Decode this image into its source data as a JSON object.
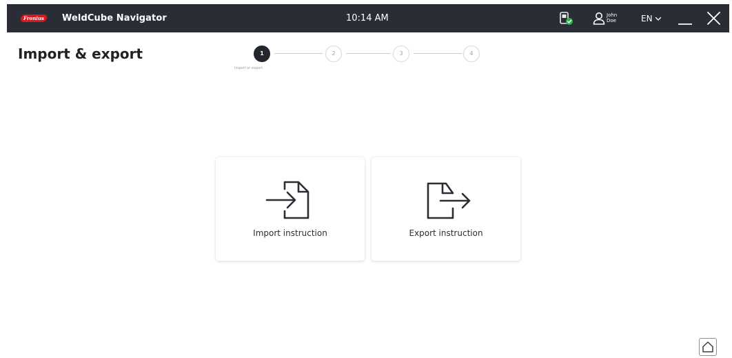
{
  "topbar": {
    "brand_logo_text": "Fronius",
    "app_title": "WeldCube Navigator",
    "clock": "10:14 AM",
    "device_status_icon": "device-connected-icon",
    "user": {
      "first_name": "John",
      "last_name": "Doe"
    },
    "language": "EN",
    "colors": {
      "background": "#2a2d36",
      "brand_red": "#d8171f",
      "status_green": "#2fb34a"
    }
  },
  "page": {
    "title": "Import & export"
  },
  "stepper": {
    "steps": [
      {
        "number": "1",
        "state": "active",
        "caption": "Import or export"
      },
      {
        "number": "2",
        "state": "inactive"
      },
      {
        "number": "3",
        "state": "inactive"
      },
      {
        "number": "4",
        "state": "inactive"
      }
    ]
  },
  "actions": {
    "import": {
      "label": "Import instruction",
      "icon": "file-import-icon"
    },
    "export": {
      "label": "Export instruction",
      "icon": "file-export-icon"
    }
  },
  "footer": {
    "home_icon": "home-icon"
  }
}
